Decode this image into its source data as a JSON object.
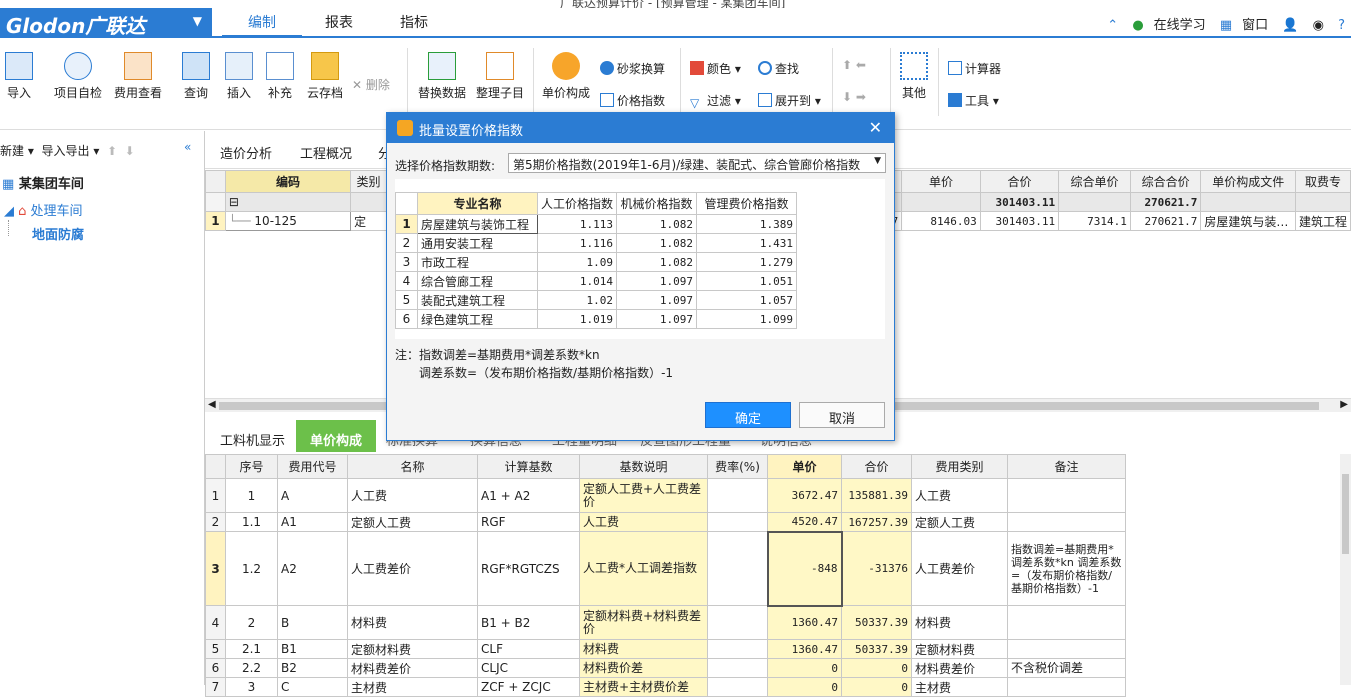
{
  "window": {
    "title": "广联达预算计价 - [预算管理 - 某集团车间]"
  },
  "app": {
    "logo": "Glodon广联达"
  },
  "menu": {
    "items": [
      "编制",
      "报表",
      "指标"
    ],
    "right": {
      "online": "在线学习",
      "window": "窗口"
    }
  },
  "toolbar": {
    "import": "导入",
    "self_check": "项目自检",
    "fee_check": "费用查看",
    "query": "查询",
    "insert": "插入",
    "supplement": "补充",
    "cloud": "云存档",
    "delete": "删除",
    "replace": "替换数据",
    "organize": "整理子目",
    "unit_price": "单价构成",
    "mortar": "砂浆换算",
    "price_index": "价格指数",
    "color": "颜色",
    "find": "查找",
    "filter": "过滤",
    "expand": "展开到",
    "other": "其他",
    "calculator": "计算器",
    "tools": "工具"
  },
  "left": {
    "new": "新建",
    "import_export": "导入导出",
    "tree": [
      "某集团车间",
      "处理车间",
      "地面防腐"
    ]
  },
  "upper_tabs": [
    "造价分析",
    "工程概况",
    "分"
  ],
  "upper_table": {
    "headers_left": [
      "编码",
      "类别"
    ],
    "row_code": "10-125",
    "row_type": "定",
    "row_num": "1",
    "headers_right": [
      "单价",
      "合价",
      "综合单价",
      "综合合价",
      "单价构成文件",
      "取费专"
    ],
    "sum": [
      "",
      "301403.11",
      "",
      "270621.7",
      "",
      ""
    ],
    "row": [
      "7",
      "8146.03",
      "301403.11",
      "7314.1",
      "270621.7",
      "房屋建筑与装…",
      "建筑工程"
    ]
  },
  "lower_tabs": [
    "工料机显示",
    "单价构成",
    "标准换算",
    "换算信息",
    "工程量明细",
    "反查图形工程量",
    "说明信息"
  ],
  "lower_table": {
    "headers": [
      "",
      "序号",
      "费用代号",
      "名称",
      "计算基数",
      "基数说明",
      "费率(%)",
      "单价",
      "合价",
      "费用类别",
      "备注"
    ],
    "rows": [
      [
        "1",
        "1",
        "A",
        "人工费",
        "A1 + A2",
        "定额人工费+人工费差价",
        "",
        "3672.47",
        "135881.39",
        "人工费",
        ""
      ],
      [
        "2",
        "1.1",
        "A1",
        "定额人工费",
        "RGF",
        "人工费",
        "",
        "4520.47",
        "167257.39",
        "定额人工费",
        ""
      ],
      [
        "3",
        "1.2",
        "A2",
        "人工费差价",
        "RGF*RGTCZS",
        "人工费*人工调差指数",
        "",
        "-848",
        "-31376",
        "人工费差价",
        "指数调差=基期费用*调差系数*kn 调差系数=（发布期价格指数/基期价格指数）-1"
      ],
      [
        "4",
        "2",
        "B",
        "材料费",
        "B1 + B2",
        "定额材料费+材料费差价",
        "",
        "1360.47",
        "50337.39",
        "材料费",
        ""
      ],
      [
        "5",
        "2.1",
        "B1",
        "定额材料费",
        "CLF",
        "材料费",
        "",
        "1360.47",
        "50337.39",
        "定额材料费",
        ""
      ],
      [
        "6",
        "2.2",
        "B2",
        "材料费差价",
        "CLJC",
        "材料费价差",
        "",
        "0",
        "0",
        "材料费差价",
        "不含税价调差"
      ],
      [
        "7",
        "3",
        "C",
        "主材费",
        "ZCF + ZCJC",
        "主材费+主材费价差",
        "",
        "0",
        "0",
        "主材费",
        ""
      ]
    ]
  },
  "dialog": {
    "title": "批量设置价格指数",
    "period_label": "选择价格指数期数:",
    "period_value": "第5期价格指数(2019年1-6月)/绿建、装配式、综合管廊价格指数",
    "headers": [
      "",
      "专业名称",
      "人工价格指数",
      "机械价格指数",
      "管理费价格指数"
    ],
    "rows": [
      [
        "1",
        "房屋建筑与装饰工程",
        "1.113",
        "1.082",
        "1.389"
      ],
      [
        "2",
        "通用安装工程",
        "1.116",
        "1.082",
        "1.431"
      ],
      [
        "3",
        "市政工程",
        "1.09",
        "1.082",
        "1.279"
      ],
      [
        "4",
        "综合管廊工程",
        "1.014",
        "1.097",
        "1.051"
      ],
      [
        "5",
        "装配式建筑工程",
        "1.02",
        "1.097",
        "1.057"
      ],
      [
        "6",
        "绿色建筑工程",
        "1.019",
        "1.097",
        "1.099"
      ]
    ],
    "note1": "注：指数调差=基期费用*调差系数*kn",
    "note2": "调差系数=（发布期价格指数/基期价格指数）-1",
    "ok": "确定",
    "cancel": "取消"
  }
}
